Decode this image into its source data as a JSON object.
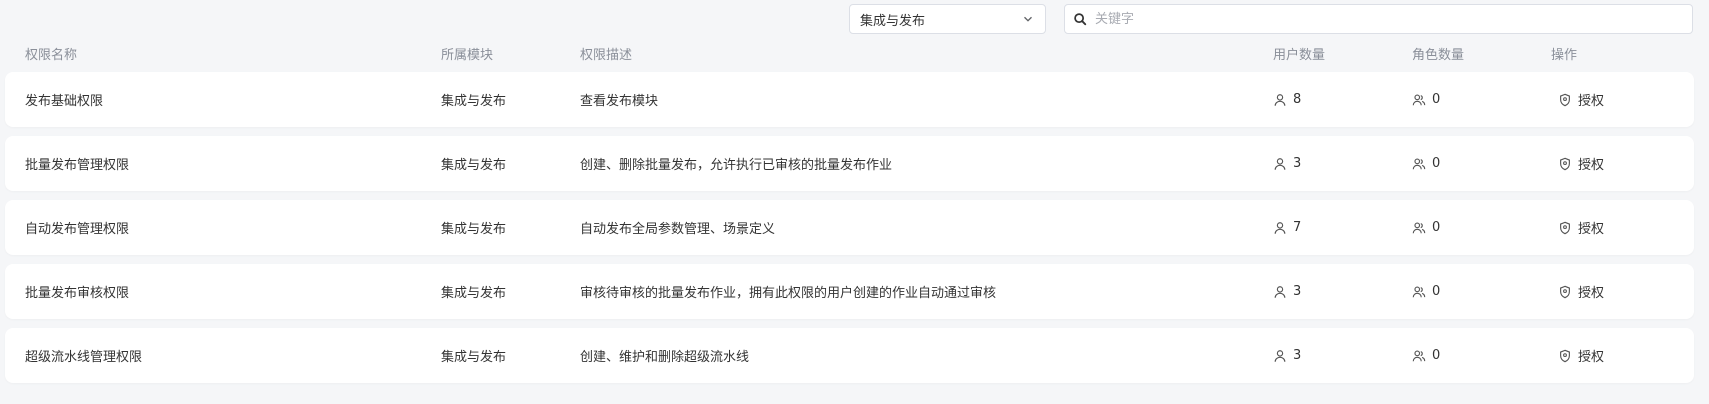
{
  "filter": {
    "module_value": "集成与发布",
    "search_placeholder": "关键字"
  },
  "columns": {
    "name": "权限名称",
    "module": "所属模块",
    "description": "权限描述",
    "users": "用户数量",
    "roles": "角色数量",
    "operation": "操作"
  },
  "rows": [
    {
      "name": "发布基础权限",
      "module": "集成与发布",
      "description": "查看发布模块",
      "users": "8",
      "roles": "0",
      "action": "授权"
    },
    {
      "name": "批量发布管理权限",
      "module": "集成与发布",
      "description": "创建、删除批量发布，允许执行已审核的批量发布作业",
      "users": "3",
      "roles": "0",
      "action": "授权"
    },
    {
      "name": "自动发布管理权限",
      "module": "集成与发布",
      "description": "自动发布全局参数管理、场景定义",
      "users": "7",
      "roles": "0",
      "action": "授权"
    },
    {
      "name": "批量发布审核权限",
      "module": "集成与发布",
      "description": "审核待审核的批量发布作业，拥有此权限的用户创建的作业自动通过审核",
      "users": "3",
      "roles": "0",
      "action": "授权"
    },
    {
      "name": "超级流水线管理权限",
      "module": "集成与发布",
      "description": "创建、维护和删除超级流水线",
      "users": "3",
      "roles": "0",
      "action": "授权"
    }
  ],
  "icons": {
    "user": "user-icon",
    "roles": "users-group-icon",
    "authorize": "shield-icon",
    "search": "search-icon",
    "dropdown": "chevron-down-icon"
  }
}
